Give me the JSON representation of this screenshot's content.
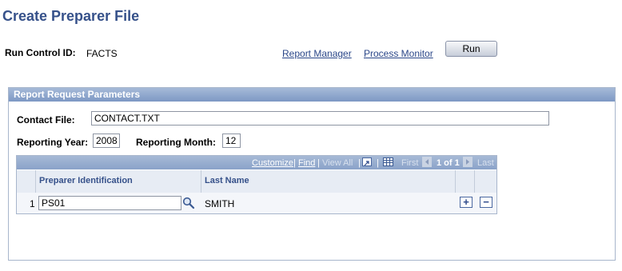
{
  "page": {
    "title": "Create Preparer File"
  },
  "run_control": {
    "label": "Run Control ID:",
    "value": "FACTS"
  },
  "links": {
    "report_manager": "Report Manager",
    "process_monitor": "Process Monitor"
  },
  "run_button": "Run",
  "section": {
    "title": "Report Request Parameters"
  },
  "contact_file": {
    "label": "Contact File:",
    "value": "CONTACT.TXT"
  },
  "reporting_year": {
    "label": "Reporting Year:",
    "value": "2008"
  },
  "reporting_month": {
    "label": "Reporting Month:",
    "value": "12"
  },
  "grid": {
    "nav": {
      "customize": "Customize",
      "find": "Find",
      "view_all": "View All",
      "first": "First",
      "count": "1 of 1",
      "last": "Last",
      "sep": "|"
    },
    "columns": [
      "Preparer Identification",
      "Last Name"
    ],
    "rows": [
      {
        "num": "1",
        "preparer_id": "PS01",
        "last_name": "SMITH"
      }
    ],
    "add_symbol": "+",
    "remove_symbol": "−"
  }
}
